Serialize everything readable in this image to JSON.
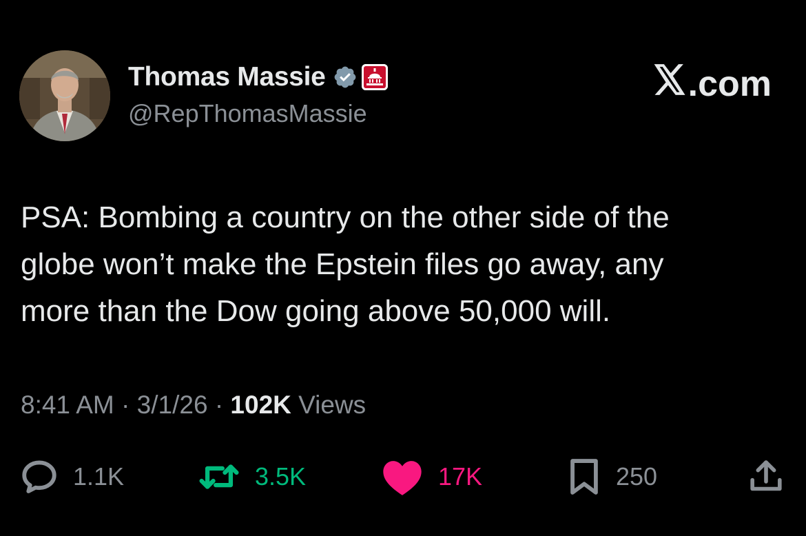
{
  "author": {
    "display_name": "Thomas Massie",
    "handle": "@RepThomasMassie",
    "verified": true
  },
  "brand": {
    "site": ".com"
  },
  "tweet": {
    "text": "PSA: Bombing a country on the other side of the\nglobe won’t make the Epstein files go away, any\nmore than the Dow going above 50,000 will."
  },
  "meta": {
    "time": "8:41 AM",
    "separator": "·",
    "date": "3/1/26",
    "views_count": "102K",
    "views_label": "Views"
  },
  "actions": {
    "replies": "1.1K",
    "reposts": "3.5K",
    "likes": "17K",
    "bookmarks": "250"
  },
  "colors": {
    "background": "#000000",
    "text": "#e7e9ea",
    "secondary": "#8b9096",
    "repost": "#00ba7c",
    "like": "#f91880",
    "verified_badge": "#829aab",
    "gov_badge": "#c8102e"
  },
  "icons": {
    "reply": "speech-bubble-icon",
    "repost": "repost-arrows-icon",
    "like": "heart-icon",
    "bookmark": "bookmark-icon",
    "share": "share-upload-icon",
    "verified": "verified-check-icon",
    "affiliation": "capitol-dome-badge-icon",
    "logo": "x-logo-icon"
  }
}
